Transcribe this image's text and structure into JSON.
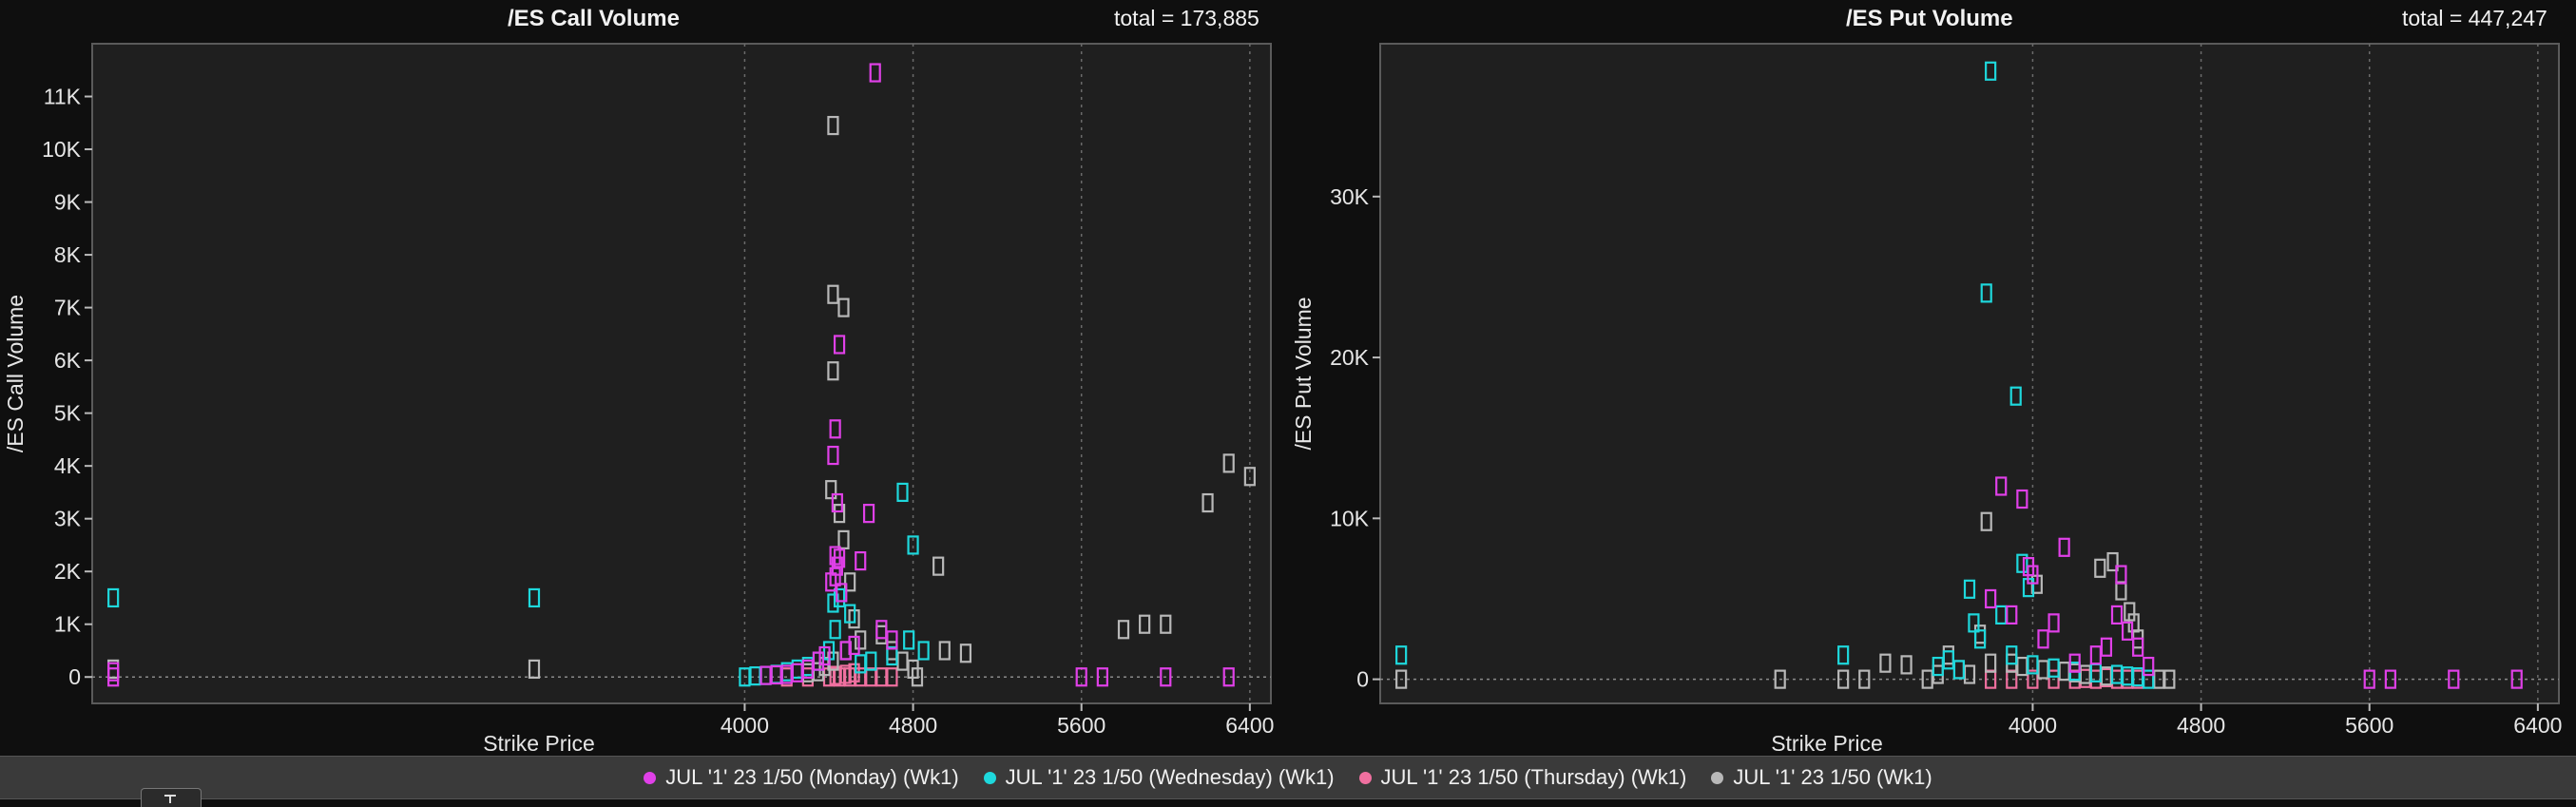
{
  "colors": {
    "monday": "#e040e8",
    "wednesday": "#1ed8dc",
    "thursday": "#f070a0",
    "wk1": "#b8b8b8",
    "plot_bg": "#1f1f1f",
    "page_bg": "#0f0f0f",
    "grid": "#6a6a6a"
  },
  "legend": [
    {
      "key": "monday",
      "label": "JUL '1' 23 1/50 (Monday) (Wk1)"
    },
    {
      "key": "wednesday",
      "label": "JUL '1' 23 1/50 (Wednesday) (Wk1)"
    },
    {
      "key": "thursday",
      "label": "JUL '1' 23 1/50 (Thursday) (Wk1)"
    },
    {
      "key": "wk1",
      "label": "JUL '1' 23 1/50 (Wk1)"
    }
  ],
  "chart_data": [
    {
      "type": "scatter",
      "title": "/ES Call Volume",
      "total": "total = 173,885",
      "xlabel": "Strike Price",
      "ylabel": "/ES Call Volume",
      "xlim": [
        900,
        6500
      ],
      "ylim": [
        -500,
        12000
      ],
      "xticks": [
        4000,
        4800,
        5600,
        6400
      ],
      "xtick_labels": [
        "4000",
        "4800",
        "5600",
        "6400"
      ],
      "yticks": [
        0,
        1000,
        2000,
        3000,
        4000,
        5000,
        6000,
        7000,
        8000,
        9000,
        10000,
        11000
      ],
      "ytick_labels": [
        "0",
        "1K",
        "2K",
        "3K",
        "4K",
        "5K",
        "6K",
        "7K",
        "8K",
        "9K",
        "10K",
        "11K"
      ],
      "grid": "vertical dotted at x ticks",
      "marker": "hollow square",
      "series": [
        {
          "key": "monday",
          "points": [
            [
              1000,
              0
            ],
            [
              1000,
              100
            ],
            [
              4620,
              11450
            ],
            [
              4450,
              6300
            ],
            [
              4430,
              4700
            ],
            [
              4420,
              4200
            ],
            [
              4440,
              3300
            ],
            [
              4430,
              2300
            ],
            [
              4450,
              2250
            ],
            [
              4440,
              2100
            ],
            [
              4430,
              1900
            ],
            [
              4410,
              1800
            ],
            [
              4460,
              1600
            ],
            [
              4550,
              2200
            ],
            [
              4590,
              3100
            ],
            [
              4650,
              900
            ],
            [
              4700,
              700
            ],
            [
              4520,
              600
            ],
            [
              4480,
              500
            ],
            [
              4380,
              400
            ],
            [
              4350,
              300
            ],
            [
              4300,
              150
            ],
            [
              4250,
              80
            ],
            [
              4200,
              50
            ],
            [
              4150,
              40
            ],
            [
              4100,
              30
            ],
            [
              5600,
              0
            ],
            [
              5700,
              0
            ],
            [
              6000,
              0
            ],
            [
              6300,
              0
            ]
          ]
        },
        {
          "key": "wednesday",
          "points": [
            [
              1000,
              1500
            ],
            [
              3000,
              1500
            ],
            [
              4750,
              3500
            ],
            [
              4800,
              2500
            ],
            [
              4780,
              700
            ],
            [
              4850,
              500
            ],
            [
              4700,
              400
            ],
            [
              4600,
              300
            ],
            [
              4550,
              250
            ],
            [
              4450,
              1500
            ],
            [
              4430,
              900
            ],
            [
              4400,
              500
            ],
            [
              4350,
              300
            ],
            [
              4300,
              200
            ],
            [
              4250,
              150
            ],
            [
              4200,
              100
            ],
            [
              4150,
              50
            ],
            [
              4100,
              30
            ],
            [
              4050,
              20
            ],
            [
              4000,
              0
            ],
            [
              4500,
              1200
            ],
            [
              4420,
              1400
            ]
          ]
        },
        {
          "key": "thursday",
          "points": [
            [
              4200,
              0
            ],
            [
              4300,
              0
            ],
            [
              4400,
              0
            ],
            [
              4450,
              0
            ],
            [
              4500,
              0
            ],
            [
              4550,
              0
            ],
            [
              4600,
              0
            ],
            [
              4650,
              0
            ],
            [
              4700,
              0
            ],
            [
              4480,
              50
            ],
            [
              4520,
              80
            ],
            [
              4430,
              30
            ]
          ]
        },
        {
          "key": "wk1",
          "points": [
            [
              1000,
              150
            ],
            [
              3000,
              150
            ],
            [
              4420,
              10450
            ],
            [
              4420,
              7250
            ],
            [
              4470,
              7000
            ],
            [
              4420,
              5800
            ],
            [
              4410,
              3550
            ],
            [
              4450,
              3100
            ],
            [
              4470,
              2600
            ],
            [
              4500,
              1800
            ],
            [
              4520,
              1100
            ],
            [
              4550,
              700
            ],
            [
              4480,
              500
            ],
            [
              4420,
              300
            ],
            [
              4380,
              200
            ],
            [
              4650,
              800
            ],
            [
              4700,
              500
            ],
            [
              4750,
              300
            ],
            [
              4800,
              150
            ],
            [
              4820,
              0
            ],
            [
              4920,
              2100
            ],
            [
              4950,
              500
            ],
            [
              5050,
              450
            ],
            [
              5800,
              900
            ],
            [
              5900,
              1000
            ],
            [
              6000,
              1000
            ],
            [
              6200,
              3300
            ],
            [
              6300,
              4050
            ],
            [
              6400,
              3800
            ],
            [
              4350,
              100
            ],
            [
              4300,
              80
            ]
          ]
        }
      ]
    },
    {
      "type": "scatter",
      "title": "/ES Put Volume",
      "total": "total = 447,247",
      "xlabel": "Strike Price",
      "ylabel": "/ES Put Volume",
      "xlim": [
        900,
        6500
      ],
      "ylim": [
        -1500,
        39500
      ],
      "xticks": [
        4000,
        4800,
        5600,
        6400
      ],
      "xtick_labels": [
        "4000",
        "4800",
        "5600",
        "6400"
      ],
      "yticks": [
        0,
        10000,
        20000,
        30000
      ],
      "ytick_labels": [
        "0",
        "10K",
        "20K",
        "30K"
      ],
      "grid": "vertical dotted at x ticks",
      "marker": "hollow square",
      "series": [
        {
          "key": "monday",
          "points": [
            [
              3850,
              12000
            ],
            [
              3950,
              11200
            ],
            [
              3800,
              5000
            ],
            [
              3900,
              4000
            ],
            [
              3980,
              7000
            ],
            [
              4000,
              6500
            ],
            [
              4150,
              8200
            ],
            [
              4100,
              3500
            ],
            [
              4050,
              2500
            ],
            [
              4450,
              3000
            ],
            [
              4400,
              4000
            ],
            [
              4420,
              6500
            ],
            [
              4350,
              2000
            ],
            [
              4500,
              2000
            ],
            [
              4300,
              1500
            ],
            [
              4200,
              1000
            ],
            [
              4550,
              800
            ],
            [
              5600,
              0
            ],
            [
              5700,
              0
            ],
            [
              6000,
              0
            ],
            [
              6300,
              0
            ]
          ]
        },
        {
          "key": "wednesday",
          "points": [
            [
              1000,
              1500
            ],
            [
              3100,
              1500
            ],
            [
              3800,
              37800
            ],
            [
              3780,
              24000
            ],
            [
              3920,
              17600
            ],
            [
              3950,
              7200
            ],
            [
              3980,
              5700
            ],
            [
              3700,
              5600
            ],
            [
              3850,
              4000
            ],
            [
              3720,
              3500
            ],
            [
              3750,
              2500
            ],
            [
              3900,
              1500
            ],
            [
              3600,
              1200
            ],
            [
              3550,
              800
            ],
            [
              3650,
              600
            ],
            [
              4000,
              900
            ],
            [
              4100,
              700
            ],
            [
              4200,
              500
            ],
            [
              4300,
              400
            ],
            [
              4400,
              300
            ],
            [
              4450,
              200
            ],
            [
              4500,
              150
            ],
            [
              4550,
              0
            ]
          ]
        },
        {
          "key": "thursday",
          "points": [
            [
              3800,
              0
            ],
            [
              3900,
              0
            ],
            [
              4000,
              0
            ],
            [
              4100,
              0
            ],
            [
              4200,
              0
            ],
            [
              4300,
              0
            ],
            [
              4400,
              0
            ],
            [
              4450,
              0
            ],
            [
              4500,
              0
            ],
            [
              4350,
              100
            ],
            [
              4250,
              50
            ]
          ]
        },
        {
          "key": "wk1",
          "points": [
            [
              1000,
              0
            ],
            [
              3100,
              0
            ],
            [
              3800,
              1000
            ],
            [
              3780,
              9800
            ],
            [
              3750,
              2800
            ],
            [
              4020,
              5900
            ],
            [
              4320,
              6900
            ],
            [
              4380,
              7300
            ],
            [
              4420,
              5500
            ],
            [
              4460,
              4200
            ],
            [
              4480,
              3500
            ],
            [
              4500,
              2500
            ],
            [
              3900,
              1000
            ],
            [
              3950,
              800
            ],
            [
              4050,
              600
            ],
            [
              4150,
              500
            ],
            [
              4200,
              400
            ],
            [
              4250,
              300
            ],
            [
              4350,
              200
            ],
            [
              4600,
              0
            ],
            [
              4650,
              0
            ],
            [
              3400,
              900
            ],
            [
              3550,
              300
            ],
            [
              3500,
              0
            ],
            [
              3600,
              1500
            ],
            [
              3650,
              600
            ],
            [
              3700,
              300
            ],
            [
              2800,
              0
            ],
            [
              3300,
              1000
            ],
            [
              3200,
              0
            ]
          ]
        }
      ]
    }
  ]
}
